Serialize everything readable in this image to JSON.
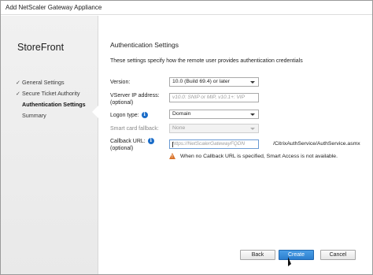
{
  "window": {
    "title": "Add NetScaler Gateway Appliance"
  },
  "sidebar": {
    "heading": "StoreFront",
    "steps": [
      {
        "label": "General Settings",
        "mark": "✓"
      },
      {
        "label": "Secure Ticket Authority",
        "mark": "✓"
      },
      {
        "label": "Authentication Settings",
        "mark": ""
      },
      {
        "label": "Summary",
        "mark": ""
      }
    ]
  },
  "main": {
    "title": "Authentication Settings",
    "description": "These settings specify how the remote user provides authentication credentials",
    "version": {
      "label": "Version:",
      "value": "10.0 (Build 69.4) or later"
    },
    "vserver": {
      "label_line1": "VServer IP address:",
      "label_line2": "(optional)",
      "placeholder": "v10.0: SNIP or MIP, v10.1+: VIP"
    },
    "logon": {
      "label": "Logon type:",
      "value": "Domain"
    },
    "smartcard": {
      "label": "Smart card fallback:",
      "value": "None"
    },
    "callback": {
      "label_line1": "Callback URL:",
      "label_line2": "(optional)",
      "placeholder": "https://NetScalerGatewayFQDN",
      "suffix": "/CitrixAuthService/AuthService.asmx"
    },
    "warning": "When no Callback URL is specified, Smart Access is not available."
  },
  "buttons": {
    "back": "Back",
    "create": "Create",
    "cancel": "Cancel"
  },
  "colors": {
    "accent": "#2d7fcf",
    "warning": "#d9732a",
    "info": "#1a6cc8"
  }
}
